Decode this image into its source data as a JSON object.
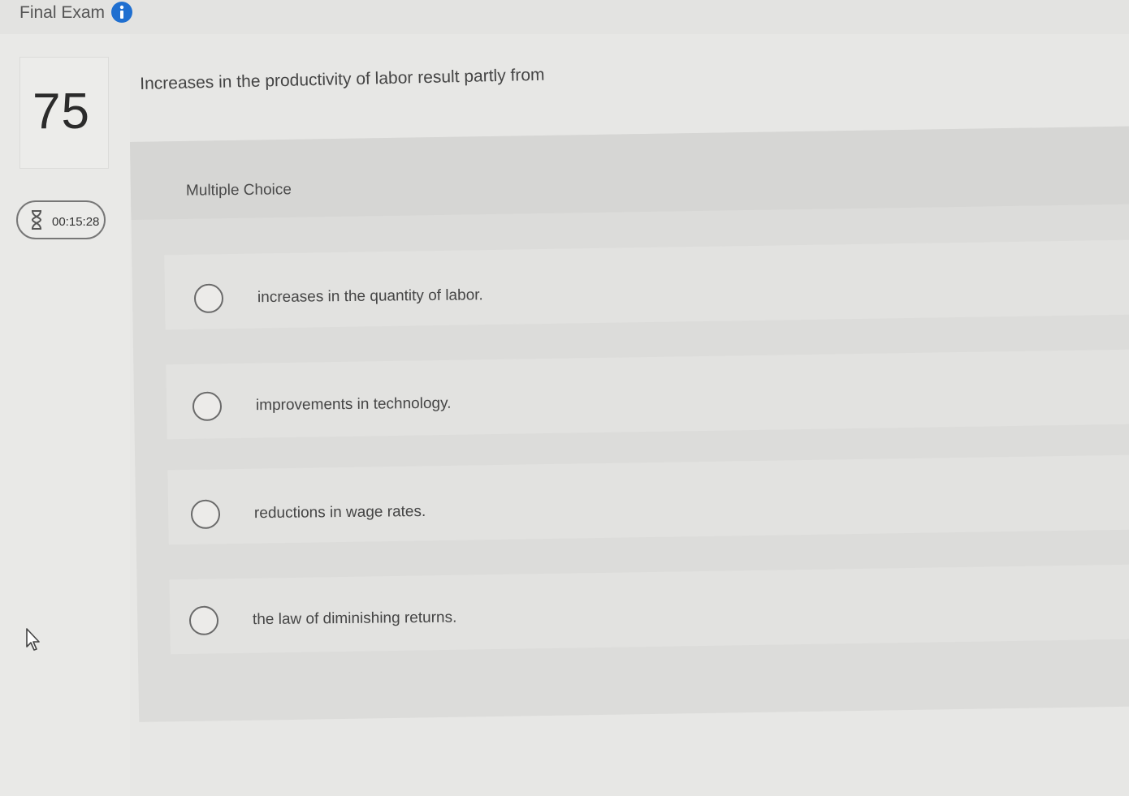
{
  "header": {
    "title": "Final Exam",
    "info_icon": "info-icon"
  },
  "question": {
    "number": "75",
    "timer": "00:15:28",
    "timer_icon": "hourglass-icon",
    "prompt": "Increases in the productivity of labor result partly from",
    "type_label": "Multiple Choice",
    "options": [
      "increases in the quantity of labor.",
      "improvements in technology.",
      "reductions in wage rates.",
      "the law of diminishing returns."
    ]
  },
  "colors": {
    "info_blue": "#1f6fd0",
    "background": "#e7e7e5",
    "panel": "#dcdcda"
  }
}
